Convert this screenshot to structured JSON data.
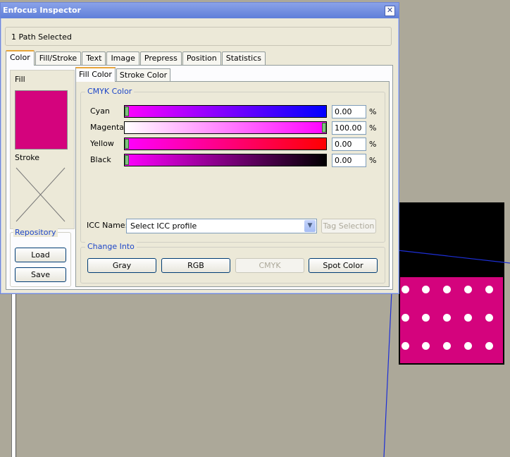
{
  "window": {
    "title": "Enfocus Inspector",
    "close_glyph": "✕",
    "status_text": "1 Path Selected"
  },
  "tabs": [
    "Color",
    "Fill/Stroke",
    "Text",
    "Image",
    "Prepress",
    "Position",
    "Statistics"
  ],
  "left": {
    "fill_label": "Fill",
    "fill_color": "#d4037d",
    "stroke_label": "Stroke",
    "repository": {
      "title": "Repository",
      "load": "Load",
      "save": "Save"
    }
  },
  "subtabs": [
    "Fill Color",
    "Stroke Color"
  ],
  "cmyk": {
    "title": "CMYK Color",
    "rows": [
      {
        "label": "Cyan",
        "value": "0.00",
        "pct": "%"
      },
      {
        "label": "Magenta",
        "value": "100.00",
        "pct": "%"
      },
      {
        "label": "Yellow",
        "value": "0.00",
        "pct": "%"
      },
      {
        "label": "Black",
        "value": "0.00",
        "pct": "%"
      }
    ],
    "icc_label": "ICC Name:",
    "icc_value": "Select ICC profile",
    "tag_selection": "Tag Selection"
  },
  "change_into": {
    "title": "Change Into",
    "buttons": [
      "Gray",
      "RGB",
      "CMYK",
      "Spot Color"
    ]
  },
  "colors": {
    "magenta": "#d4037d",
    "title_bar": "#5f7fd9",
    "accent_blue": "#1e46c8"
  }
}
